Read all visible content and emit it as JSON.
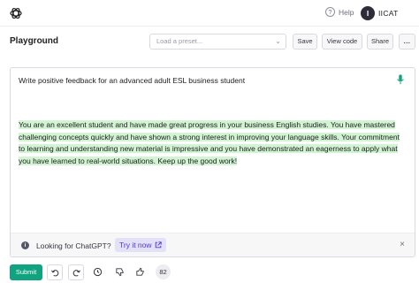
{
  "topbar": {
    "logo_icon": "openai-logo-icon",
    "help_label": "Help",
    "help_icon_glyph": "?",
    "user_initial": "I",
    "user_name": "IICAT"
  },
  "toolbar": {
    "title": "Playground",
    "preset_placeholder": "Load a preset...",
    "save_label": "Save",
    "view_code_label": "View code",
    "share_label": "Share",
    "more_label": "..."
  },
  "editor": {
    "prompt": "Write positive feedback for an advanced adult ESL business student",
    "completion": "You are an excellent student and have made great progress in your business English studies. You have mastered challenging concepts quickly and have shown a strong interest in improving your language skills. Your commitment to learning and understanding new material is impressive and you have demonstrated an eagerness to apply what you have learned to real-world situations. Keep up the good work!",
    "completion_highlight_color": "#d2f4d3"
  },
  "banner": {
    "info_glyph": "i",
    "text": "Looking for ChatGPT?",
    "link_label": "Try it now",
    "close_glyph": "×"
  },
  "footer": {
    "submit_label": "Submit",
    "token_count": "82"
  },
  "colors": {
    "accent": "#10a37f",
    "link": "#5436da"
  }
}
